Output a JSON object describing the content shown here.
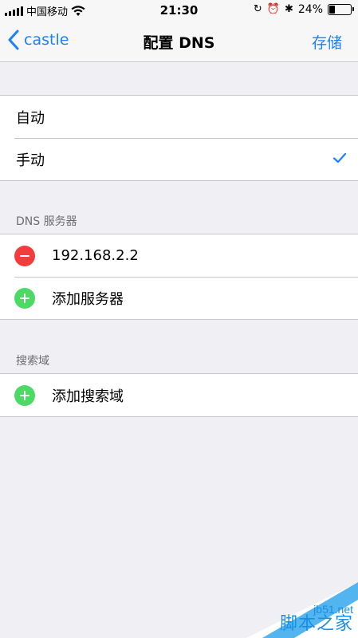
{
  "status_bar": {
    "carrier": "中国移动",
    "time": "21:30",
    "battery_percent": "24%",
    "battery_level": 0.24
  },
  "nav": {
    "back_label": "castle",
    "title": "配置 DNS",
    "save_label": "存储"
  },
  "mode_options": [
    {
      "label": "自动",
      "selected": false
    },
    {
      "label": "手动",
      "selected": true
    }
  ],
  "dns_section": {
    "header": "DNS 服务器",
    "servers": [
      "192.168.2.2"
    ],
    "add_label": "添加服务器"
  },
  "search_section": {
    "header": "搜索域",
    "add_label": "添加搜索域"
  },
  "watermark": {
    "url": "jb51.net",
    "text": "脚本之家"
  },
  "colors": {
    "accent": "#1a82fb",
    "delete": "#f33c3c",
    "add": "#4cd964",
    "background": "#efeff4"
  }
}
